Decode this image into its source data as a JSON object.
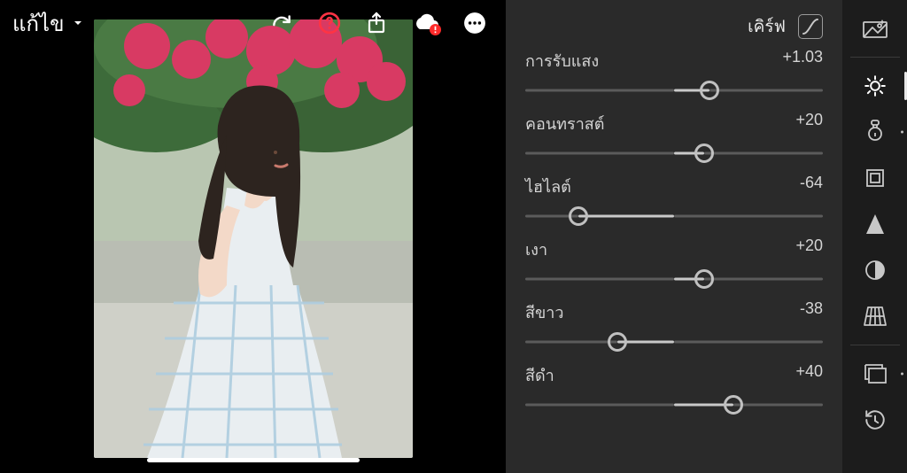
{
  "header": {
    "mode_label": "แก้ไข",
    "curve_label": "เคิร์ฟ"
  },
  "sliders": [
    {
      "label": "การรับแสง",
      "value": "+1.03",
      "pos": 62
    },
    {
      "label": "คอนทราสต์",
      "value": "+20",
      "pos": 60
    },
    {
      "label": "ไฮไลต์",
      "value": "-64",
      "pos": 18
    },
    {
      "label": "เงา",
      "value": "+20",
      "pos": 60
    },
    {
      "label": "สีขาว",
      "value": "-38",
      "pos": 31
    },
    {
      "label": "สีดำ",
      "value": "+40",
      "pos": 70
    }
  ],
  "rail_icons": [
    "auto-icon",
    "light-icon",
    "color-icon",
    "crop-icon",
    "effects-icon",
    "optics-icon",
    "geometry-icon",
    "presets-icon",
    "versions-icon"
  ]
}
